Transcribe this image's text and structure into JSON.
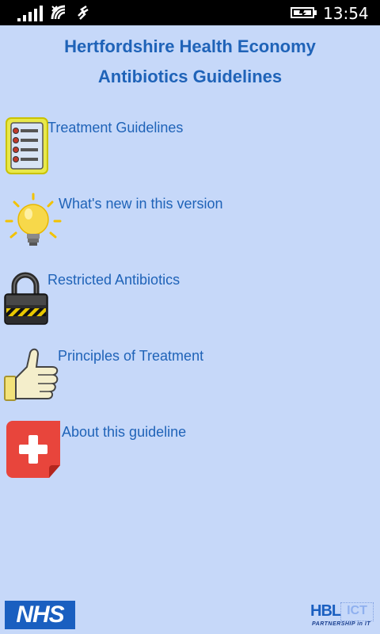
{
  "status_bar": {
    "time": "13:54",
    "icons": [
      "signal-icon",
      "wifi-icon",
      "data-sync-icon",
      "battery-charging-icon"
    ]
  },
  "header": {
    "title_line1": "Hertfordshire Health Economy",
    "title_line2": "Antibiotics Guidelines"
  },
  "menu": {
    "items": [
      {
        "label": "Treatment Guidelines",
        "icon": "checklist-icon"
      },
      {
        "label": "What's new in this version",
        "icon": "lightbulb-icon"
      },
      {
        "label": "Restricted Antibiotics",
        "icon": "padlock-icon"
      },
      {
        "label": "Principles of Treatment",
        "icon": "thumbs-up-icon"
      },
      {
        "label": "About this guideline",
        "icon": "first-aid-icon"
      }
    ]
  },
  "footer": {
    "nhs_logo_text": "NHS",
    "partner_logo_text": "HBL",
    "partner_logo_suffix": "ICT",
    "partner_tagline": "PARTNERSHIP in IT"
  },
  "colors": {
    "background": "#c6d8f9",
    "title_text": "#1f63b8",
    "link_text": "#1f63b8",
    "nhs_blue": "#1a5fc0",
    "status_bar": "#000000"
  }
}
